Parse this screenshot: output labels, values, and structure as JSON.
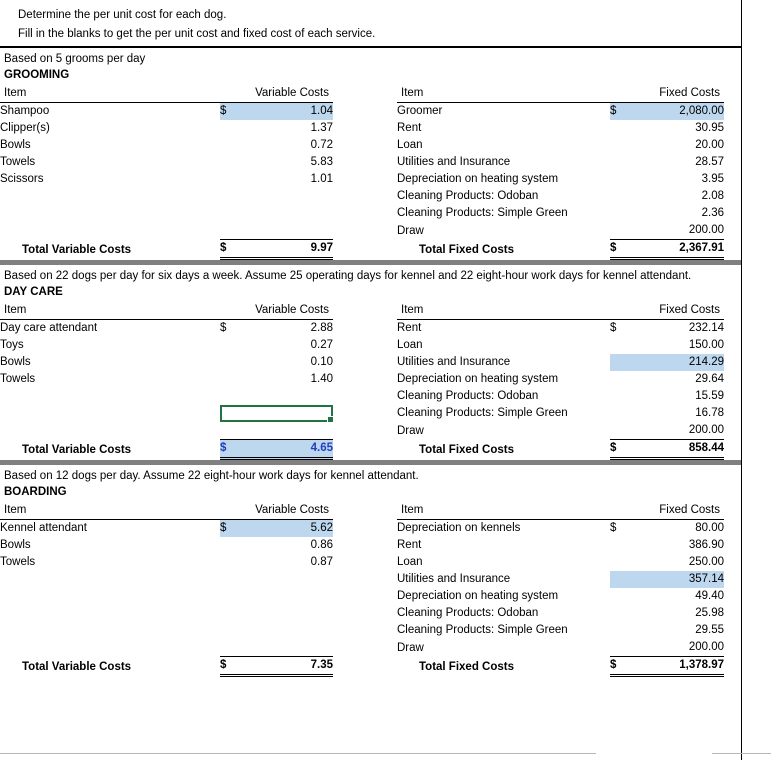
{
  "instructions": {
    "line1": "Determine the per unit cost for each dog.",
    "line2": "Fill in the blanks to get the per unit cost and fixed cost of each service."
  },
  "colors": {
    "highlight_fill": "#bdd7ee",
    "separator_bar": "#808080",
    "active_cell_border": "#217346",
    "blue_text": "#1f3fbf"
  },
  "headers": {
    "item": "Item",
    "variable_costs": "Variable Costs",
    "fixed_costs": "Fixed Costs",
    "total_variable": "Total Variable Costs",
    "total_fixed": "Total Fixed Costs",
    "currency": "$"
  },
  "sections": [
    {
      "basis": "Based on 5 grooms per day",
      "title": "GROOMING",
      "variable": {
        "rows": [
          {
            "item": "Shampoo",
            "currency": "$",
            "value": "1.04",
            "highlight": true,
            "bold": false
          },
          {
            "item": "Clipper(s)",
            "currency": "",
            "value": "1.37",
            "highlight": false,
            "bold": false
          },
          {
            "item": "Bowls",
            "currency": "",
            "value": "0.72",
            "highlight": false,
            "bold": false
          },
          {
            "item": "Towels",
            "currency": "",
            "value": "5.83",
            "highlight": false,
            "bold": false
          },
          {
            "item": "Scissors",
            "currency": "",
            "value": "1.01",
            "highlight": false,
            "bold": false
          }
        ],
        "blank_rows": 3,
        "total": {
          "label": "Total Variable Costs",
          "currency": "$",
          "value": "9.97",
          "highlight": false
        }
      },
      "fixed": {
        "rows": [
          {
            "item": "Groomer",
            "currency": "$",
            "value": "2,080.00",
            "highlight": true,
            "bold": false
          },
          {
            "item": "Rent",
            "currency": "",
            "value": "30.95",
            "highlight": false,
            "bold": false
          },
          {
            "item": "Loan",
            "currency": "",
            "value": "20.00",
            "highlight": false,
            "bold": false
          },
          {
            "item": "Utilities and Insurance",
            "currency": "",
            "value": "28.57",
            "highlight": false,
            "bold": false
          },
          {
            "item": "Depreciation on heating system",
            "currency": "",
            "value": "3.95",
            "highlight": false,
            "bold": false
          },
          {
            "item": "Cleaning Products: Odoban",
            "currency": "",
            "value": "2.08",
            "highlight": false,
            "bold": false
          },
          {
            "item": "Cleaning Products: Simple Green",
            "currency": "",
            "value": "2.36",
            "highlight": false,
            "bold": false
          },
          {
            "item": "Draw",
            "currency": "",
            "value": "200.00",
            "highlight": false,
            "bold": false
          }
        ],
        "blank_rows": 0,
        "total": {
          "label": "Total Fixed Costs",
          "currency": "$",
          "value": "2,367.91",
          "highlight": false
        }
      }
    },
    {
      "basis": "Based on 22 dogs per day for six days a week. Assume 25 operating days for kennel and 22 eight-hour work days for kennel attendant.",
      "title": "DAY CARE",
      "variable": {
        "rows": [
          {
            "item": "Day care attendant",
            "currency": "$",
            "value": "2.88",
            "highlight": false,
            "bold": false
          },
          {
            "item": "Toys",
            "currency": "",
            "value": "0.27",
            "highlight": false,
            "bold": false
          },
          {
            "item": "Bowls",
            "currency": "",
            "value": "0.10",
            "highlight": false,
            "bold": true
          },
          {
            "item": "Towels",
            "currency": "",
            "value": "1.40",
            "highlight": false,
            "bold": false
          }
        ],
        "blank_rows": 3,
        "selected_blank_row_index": 1,
        "total": {
          "label": "Total Variable Costs",
          "currency": "$",
          "value": "4.65",
          "highlight": true,
          "blue_text": true
        }
      },
      "fixed": {
        "rows": [
          {
            "item": "Rent",
            "currency": "$",
            "value": "232.14",
            "highlight": false,
            "bold": false
          },
          {
            "item": "Loan",
            "currency": "",
            "value": "150.00",
            "highlight": false,
            "bold": false
          },
          {
            "item": "Utilities and Insurance",
            "currency": "",
            "value": "214.29",
            "highlight": true,
            "bold": false
          },
          {
            "item": "Depreciation on heating system",
            "currency": "",
            "value": "29.64",
            "highlight": false,
            "bold": false
          },
          {
            "item": "Cleaning Products: Odoban",
            "currency": "",
            "value": "15.59",
            "highlight": false,
            "bold": false
          },
          {
            "item": "Cleaning Products: Simple Green",
            "currency": "",
            "value": "16.78",
            "highlight": false,
            "bold": true
          },
          {
            "item": "Draw",
            "currency": "",
            "value": "200.00",
            "highlight": false,
            "bold": false
          }
        ],
        "blank_rows": 0,
        "total": {
          "label": "Total Fixed Costs",
          "currency": "$",
          "value": "858.44",
          "highlight": false
        }
      }
    },
    {
      "basis": "Based on 12 dogs per day. Assume 22 eight-hour work days for kennel attendant.",
      "title": "BOARDING",
      "variable": {
        "rows": [
          {
            "item": "Kennel attendant",
            "currency": "$",
            "value": "5.62",
            "highlight": true,
            "bold": false
          },
          {
            "item": "Bowls",
            "currency": "",
            "value": "0.86",
            "highlight": false,
            "bold": false
          },
          {
            "item": "Towels",
            "currency": "",
            "value": "0.87",
            "highlight": false,
            "bold": false
          }
        ],
        "blank_rows": 5,
        "total": {
          "label": "Total Variable Costs",
          "currency": "$",
          "value": "7.35",
          "highlight": false
        }
      },
      "fixed": {
        "rows": [
          {
            "item": "Depreciation on kennels",
            "currency": "$",
            "value": "80.00",
            "highlight": false,
            "bold": false
          },
          {
            "item": "Rent",
            "currency": "",
            "value": "386.90",
            "highlight": false,
            "bold": false
          },
          {
            "item": "Loan",
            "currency": "",
            "value": "250.00",
            "highlight": false,
            "bold": false
          },
          {
            "item": "Utilities and Insurance",
            "currency": "",
            "value": "357.14",
            "highlight": true,
            "bold": false
          },
          {
            "item": "Depreciation on heating system",
            "currency": "",
            "value": "49.40",
            "highlight": false,
            "bold": false
          },
          {
            "item": "Cleaning Products: Odoban",
            "currency": "",
            "value": "25.98",
            "highlight": false,
            "bold": false
          },
          {
            "item": "Cleaning Products: Simple Green",
            "currency": "",
            "value": "29.55",
            "highlight": false,
            "bold": false
          },
          {
            "item": "Draw",
            "currency": "",
            "value": "200.00",
            "highlight": false,
            "bold": false
          }
        ],
        "blank_rows": 0,
        "total": {
          "label": "Total Fixed Costs",
          "currency": "$",
          "value": "1,378.97",
          "highlight": false
        }
      }
    }
  ]
}
